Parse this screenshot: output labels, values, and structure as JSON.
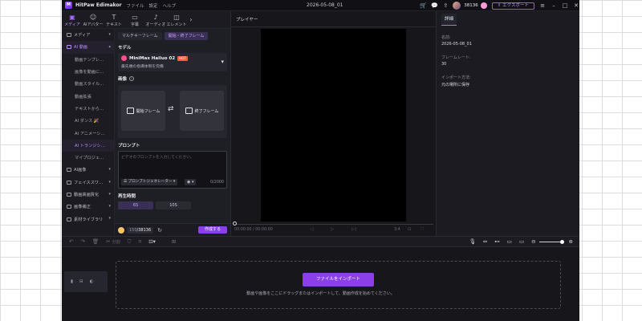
{
  "app": {
    "logo_text": "M",
    "title": "HitPaw Edimakor",
    "menu": [
      "ファイル",
      "設定",
      "ヘルプ"
    ],
    "document_title": "2026-05-08_01",
    "credits": "38136",
    "export_label": "エクスポート"
  },
  "top_tabs": [
    {
      "label": "メディア",
      "icon": "media-icon"
    },
    {
      "label": "AIアバター",
      "icon": "avatar-icon"
    },
    {
      "label": "テキスト",
      "icon": "text-icon"
    },
    {
      "label": "字幕",
      "icon": "subtitle-icon"
    },
    {
      "label": "オーディオ",
      "icon": "audio-icon"
    },
    {
      "label": "エレメント",
      "icon": "element-icon"
    }
  ],
  "sidebar": {
    "items": [
      {
        "label": "メディア",
        "type": "group"
      },
      {
        "label": "AI 動画",
        "type": "group",
        "active": true
      },
      {
        "label": "動画テンプレ…",
        "type": "sub"
      },
      {
        "label": "画像を動画に…",
        "type": "sub"
      },
      {
        "label": "動画スタイル…",
        "type": "sub"
      },
      {
        "label": "動画拡張",
        "type": "sub"
      },
      {
        "label": "テキストから…",
        "type": "sub"
      },
      {
        "label": "AI ダンス 🎉",
        "type": "sub"
      },
      {
        "label": "AI アニメーシ…",
        "type": "sub"
      },
      {
        "label": "AI トランジシ…",
        "type": "sub",
        "active": true
      },
      {
        "label": "マイプロジェ…",
        "type": "sub"
      },
      {
        "label": "AI画像",
        "type": "group"
      },
      {
        "label": "フェイススワ…",
        "type": "group"
      },
      {
        "label": "動画高画質化",
        "type": "group"
      },
      {
        "label": "画像補正",
        "type": "group"
      },
      {
        "label": "素材ライブラリ",
        "type": "group"
      }
    ]
  },
  "generator": {
    "mode_tabs": [
      "マルチキーフレーム",
      "開始・終了フレーム"
    ],
    "model_section": "モデル",
    "model_name": "MiniMax Hailuo 02",
    "model_badge": "HOT",
    "model_desc": "最先端の指導体制を完備",
    "image_section": "画像",
    "start_frame": "開始フレーム",
    "end_frame": "終了フレーム",
    "prompt_section": "プロンプト",
    "prompt_placeholder": "ビデオのプロンプトを入力してください。",
    "prompt_generator": "プロンプトジェネレーター",
    "prompt_count": "0/2000",
    "duration_section": "再生時間",
    "durations": [
      "6S",
      "10S"
    ],
    "credits_prefix": "150",
    "credits_total": "/38136",
    "create_label": "作成する"
  },
  "player": {
    "tab_label": "プレイヤー",
    "timecode": "00:00:00 / 00:00:00",
    "ratio": "3:4"
  },
  "details": {
    "tab_label": "詳細",
    "fields": [
      {
        "label": "名前:",
        "value": "2026-05-08_01"
      },
      {
        "label": "フレームレート:",
        "value": "30"
      },
      {
        "label": "インポート方法:",
        "value": "元の場所に保存"
      }
    ]
  },
  "timeline": {
    "split_label": "分割",
    "import_label": "ファイルをインポート",
    "drop_hint": "動画や画像をここにドラッグまたはインポートして、動画作成を始めてください。"
  }
}
